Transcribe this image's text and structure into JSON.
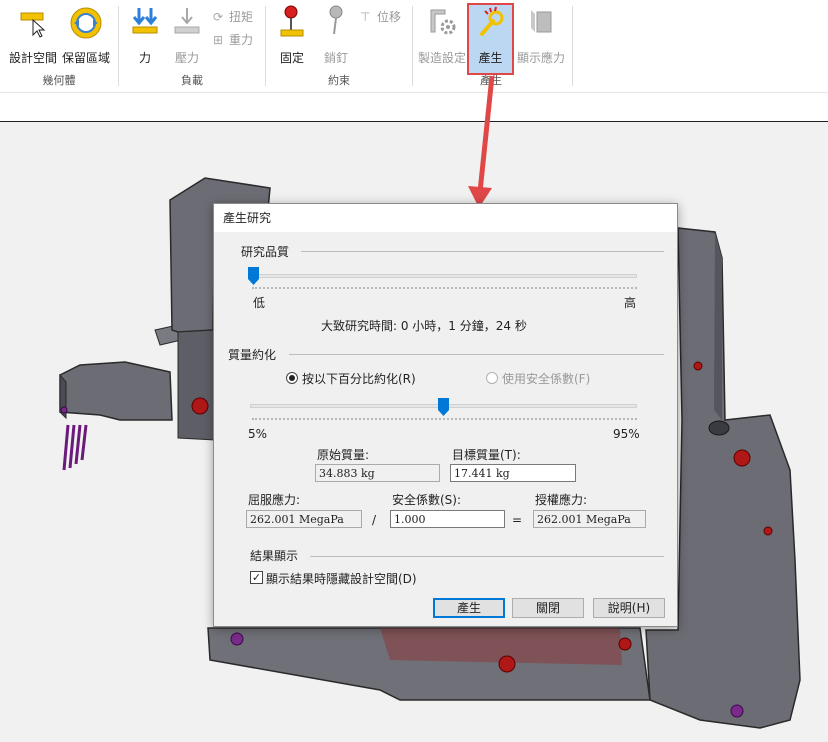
{
  "ribbon": {
    "groups": [
      {
        "label": "幾何體",
        "items": [
          {
            "label": "設計空間"
          },
          {
            "label": "保留區域"
          }
        ]
      },
      {
        "label": "負載",
        "items": [
          {
            "label": "力"
          },
          {
            "label": "壓力"
          },
          {
            "label": "扭矩"
          },
          {
            "label": "重力"
          }
        ]
      },
      {
        "label": "約束",
        "items": [
          {
            "label": "固定"
          },
          {
            "label": "銷釘"
          },
          {
            "label": "位移"
          }
        ]
      },
      {
        "label": "產生",
        "items": [
          {
            "label": "製造設定"
          },
          {
            "label": "產生"
          },
          {
            "label": "顯示應力"
          }
        ]
      }
    ]
  },
  "dialog": {
    "title": "產生研究",
    "quality": {
      "section": "研究品質",
      "low": "低",
      "high": "高",
      "slider_level": 0.0,
      "estimated_time": "大致研究時間:  0 小時，1 分鐘，24 秒"
    },
    "mass": {
      "section": "質量約化",
      "radio_percent": "按以下百分比約化(R)",
      "radio_safety": "使用安全係數(F)",
      "min": "5%",
      "max": "95%",
      "slider_level": 0.5,
      "original_label": "原始質量:",
      "original_value": "34.883 kg",
      "target_label": "目標質量(T):",
      "target_value": "17.441 kg",
      "yield_label": "屈服應力:",
      "yield_value": "262.001 MegaPa",
      "divide": "/",
      "safety_label": "安全係數(S):",
      "safety_value": "1.000",
      "equals": "=",
      "allowable_label": "授權應力:",
      "allowable_value": "262.001 MegaPa"
    },
    "results": {
      "section": "結果顯示",
      "checkbox_label": "顯示結果時隱藏設計空間(D)",
      "checked": true
    },
    "buttons": {
      "generate": "產生",
      "close": "關閉",
      "help": "說明(H)"
    }
  },
  "colors": {
    "accent": "#0078d7",
    "annotation": "#e04848",
    "part": "#6a6a72",
    "hole": "#b01818"
  }
}
